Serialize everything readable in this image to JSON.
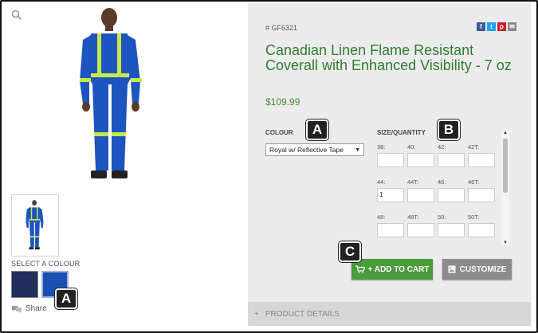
{
  "product": {
    "sku": "# GF6321",
    "title": "Canadian Linen Flame Resistant Coverall with Enhanced Visibility - 7 oz",
    "price": "$109.99"
  },
  "gallery": {
    "select_colour_label": "SELECT A COLOUR",
    "swatches": [
      {
        "name": "Navy",
        "color": "#1f2f5a"
      },
      {
        "name": "Royal",
        "color": "#1b4fb0"
      }
    ],
    "share_label": "Share"
  },
  "social": {
    "facebook": "f",
    "twitter": "t",
    "pinterest": "p",
    "email": "✉"
  },
  "colour": {
    "label": "COLOUR",
    "selected": "Royal w/ Reflective Tape"
  },
  "size": {
    "label": "SIZE/QUANTITY",
    "cells": [
      {
        "size": "38:",
        "qty": ""
      },
      {
        "size": "40:",
        "qty": ""
      },
      {
        "size": "42:",
        "qty": ""
      },
      {
        "size": "42T:",
        "qty": ""
      },
      {
        "size": "44:",
        "qty": "1"
      },
      {
        "size": "44T:",
        "qty": ""
      },
      {
        "size": "46:",
        "qty": ""
      },
      {
        "size": "46T:",
        "qty": ""
      },
      {
        "size": "48:",
        "qty": ""
      },
      {
        "size": "48T:",
        "qty": ""
      },
      {
        "size": "50:",
        "qty": ""
      },
      {
        "size": "50T:",
        "qty": ""
      }
    ]
  },
  "buttons": {
    "add_to_cart": "+ ADD TO CART",
    "customize": "CUSTOMIZE"
  },
  "details": {
    "toggle": "+",
    "label": "PRODUCT DETAILS"
  },
  "badges": {
    "a": "A",
    "b": "B",
    "c": "C"
  },
  "colors": {
    "title_green": "#2e7d2e",
    "cart_green": "#4a9b3a",
    "customize_gray": "#8c8c8c",
    "panel_bg": "#ececec"
  }
}
